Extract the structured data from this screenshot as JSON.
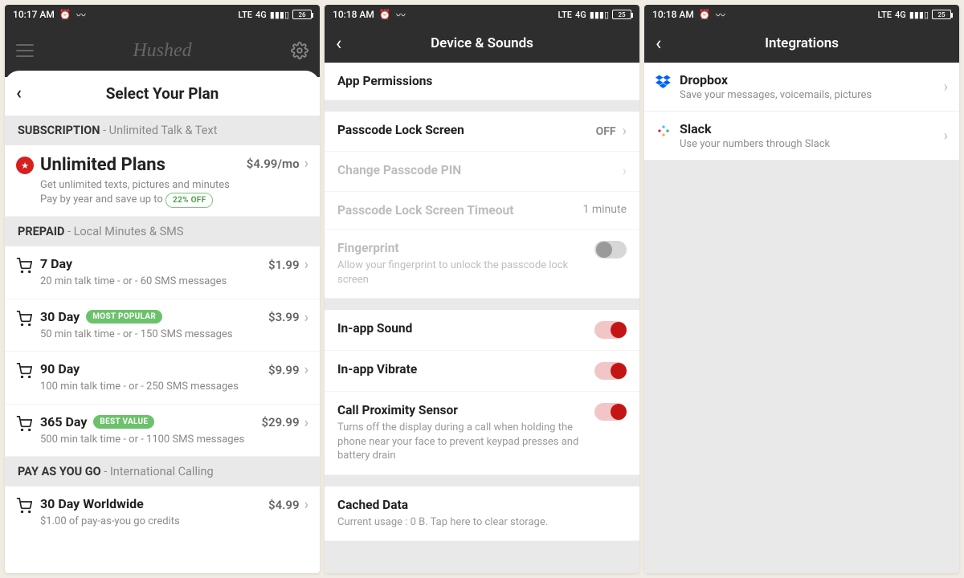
{
  "status": {
    "time1": "10:17 AM",
    "time2": "10:18 AM",
    "batt1": "26",
    "batt2": "25",
    "net": "4G"
  },
  "screen1": {
    "logo": "Hushed",
    "title": "Select Your Plan",
    "sections": [
      {
        "name": "SUBSCRIPTION",
        "sub": " - Unlimited Talk & Text"
      },
      {
        "name": "PREPAID",
        "sub": " - Local Minutes & SMS"
      },
      {
        "name": "PAY AS YOU GO",
        "sub": " - International Calling"
      }
    ],
    "unlimited": {
      "title": "Unlimited Plans",
      "price": "$4.99/mo",
      "sub1": "Get unlimited texts, pictures and minutes",
      "sub2": "Pay by year and save up to ",
      "badge": "22% OFF"
    },
    "prepaid": [
      {
        "title": "7 Day",
        "sub": "20 min talk time - or - 60 SMS messages",
        "price": "$1.99",
        "badge": ""
      },
      {
        "title": "30 Day",
        "sub": "50 min talk time - or - 150 SMS messages",
        "price": "$3.99",
        "badge": "MOST POPULAR"
      },
      {
        "title": "90 Day",
        "sub": "100 min talk time - or - 250 SMS messages",
        "price": "$9.99",
        "badge": ""
      },
      {
        "title": "365 Day",
        "sub": "500 min talk time - or - 1100 SMS messages",
        "price": "$29.99",
        "badge": "BEST VALUE"
      }
    ],
    "payg": {
      "title": "30 Day Worldwide",
      "sub": "$1.00 of pay-as-you go credits",
      "price": "$4.99"
    }
  },
  "screen2": {
    "title": "Device & Sounds",
    "app_permissions": "App Permissions",
    "passcode": {
      "title": "Passcode Lock Screen",
      "value": "OFF"
    },
    "change_pin": "Change Passcode PIN",
    "timeout": {
      "title": "Passcode Lock Screen Timeout",
      "value": "1 minute"
    },
    "fingerprint": {
      "title": "Fingerprint",
      "sub": "Allow your fingerprint to unlock the passcode lock screen"
    },
    "inapp_sound": "In-app Sound",
    "inapp_vibrate": "In-app Vibrate",
    "prox": {
      "title": "Call Proximity Sensor",
      "sub": "Turns off the display during a call when holding the phone near your face to prevent keypad presses and battery drain"
    },
    "cached": {
      "title": "Cached Data",
      "sub": "Current usage : 0 B. Tap here to clear storage."
    }
  },
  "screen3": {
    "title": "Integrations",
    "items": [
      {
        "title": "Dropbox",
        "sub": "Save your messages, voicemails, pictures"
      },
      {
        "title": "Slack",
        "sub": "Use your numbers through Slack"
      }
    ]
  }
}
